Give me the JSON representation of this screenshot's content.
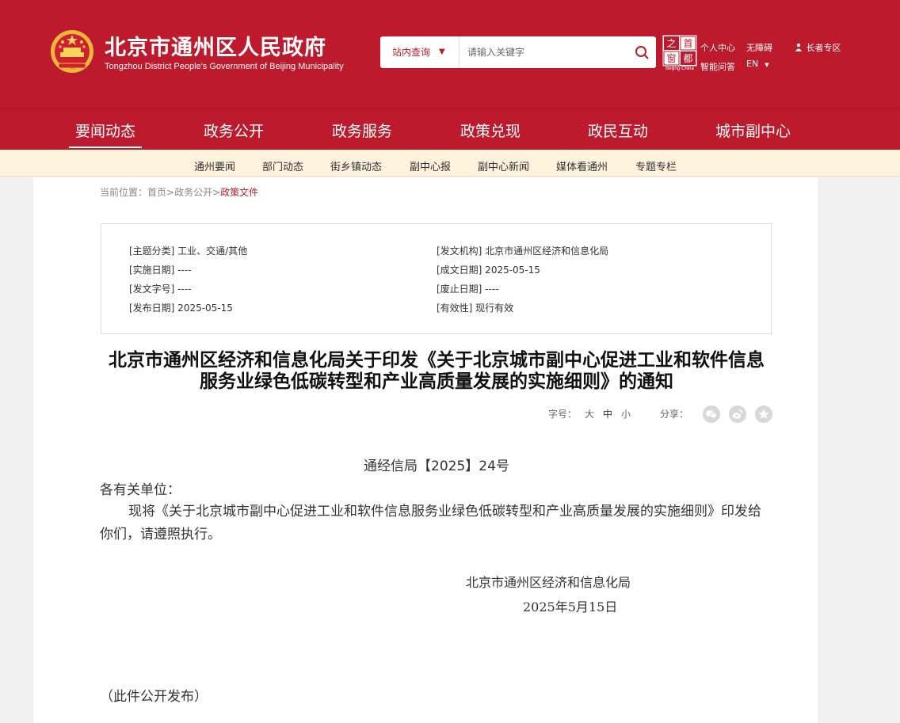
{
  "header": {
    "title": "北京市通州区人民政府",
    "subtitle": "Tongzhou District People's Government of Beijing Municipality",
    "brand_color": "#bd1a2d"
  },
  "search": {
    "scope_label": "站内查询",
    "placeholder": "请输入关键字",
    "icon": "search-icon"
  },
  "capital_logo": {
    "chars": [
      "首",
      "都",
      "之",
      "窗"
    ],
    "caption": "Beijing·China"
  },
  "top_links": {
    "personal_center": "个人中心",
    "accessibility": "无障碍",
    "smart_qa": "智能问答",
    "en": "EN",
    "elderly": "长者专区"
  },
  "main_nav": [
    {
      "label": "要闻动态",
      "active": true
    },
    {
      "label": "政务公开",
      "active": false
    },
    {
      "label": "政务服务",
      "active": false
    },
    {
      "label": "政策兑现",
      "active": false
    },
    {
      "label": "政民互动",
      "active": false
    },
    {
      "label": "城市副中心",
      "active": false
    }
  ],
  "sub_nav": [
    "通州要闻",
    "部门动态",
    "街乡镇动态",
    "副中心报",
    "副中心新闻",
    "媒体看通州",
    "专题专栏"
  ],
  "breadcrumb": {
    "prefix": "当前位置：",
    "home": "首页",
    "sep1": ">",
    "section": "政务公开",
    "sep2": ">",
    "current": "政策文件"
  },
  "meta": {
    "category": "[主题分类] 工业、交通/其他",
    "issuer": "[发文机构] 北京市通州区经济和信息化局",
    "effective_date": "[实施日期] ----",
    "written_date": "[成文日期] 2025-05-15",
    "doc_number": "[发文字号] ----",
    "repeal_date": "[废止日期] ----",
    "publish_date": "[发布日期] 2025-05-15",
    "validity": "[有效性] 现行有效"
  },
  "document": {
    "title": "北京市通州区经济和信息化局关于印发《关于北京城市副中心促进工业和软件信息服务业绿色低碳转型和产业高质量发展的实施细则》的通知",
    "doc_no": "通经信局【2025】24号",
    "salutation": "各有关单位：",
    "body": "现将《关于北京城市副中心促进工业和软件信息服务业绿色低碳转型和产业高质量发展的实施细则》印发给你们，请遵照执行。",
    "issuer": "北京市通州区经济和信息化局",
    "date": "2025年5月15日",
    "public_note": "（此件公开发布）"
  },
  "tools": {
    "font_label": "字号：",
    "font_large": "大",
    "font_medium": "中",
    "font_small": "小",
    "share_label": "分享：",
    "share_icons": [
      "wechat-icon",
      "weibo-icon",
      "favorite-icon"
    ]
  }
}
